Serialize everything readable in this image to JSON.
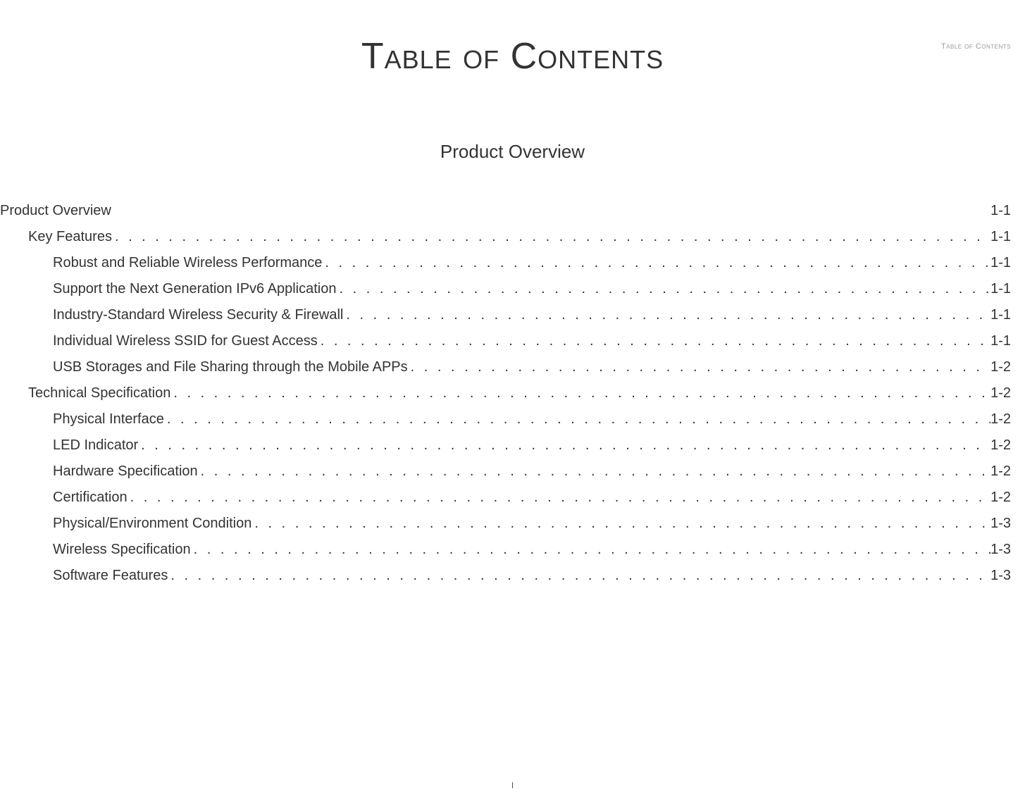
{
  "header": {
    "running_head": "Table of Contents"
  },
  "title": "Table of Contents",
  "section_title": "Product Overview",
  "toc": [
    {
      "label": "Product Overview",
      "page": "1-1",
      "level": 0,
      "leader": "space"
    },
    {
      "label": "Key Features",
      "page": "1-1",
      "level": 1,
      "leader": "dot"
    },
    {
      "label": "Robust and Reliable Wireless Performance",
      "page": "1-1",
      "level": 2,
      "leader": "dot"
    },
    {
      "label": "Support the Next Generation IPv6 Application",
      "page": "1-1",
      "level": 2,
      "leader": "dot"
    },
    {
      "label": "Industry-Standard Wireless Security & Firewall",
      "page": "1-1",
      "level": 2,
      "leader": "dot"
    },
    {
      "label": "Individual Wireless SSID for Guest Access",
      "page": "1-1",
      "level": 2,
      "leader": "dot"
    },
    {
      "label": "USB Storages and File Sharing through the Mobile APPs",
      "page": "1-2",
      "level": 2,
      "leader": "dot"
    },
    {
      "label": "Technical Specification",
      "page": "1-2",
      "level": 1,
      "leader": "dot"
    },
    {
      "label": "Physical Interface",
      "page": "1-2",
      "level": 2,
      "leader": "dot"
    },
    {
      "label": "LED Indicator",
      "page": "1-2",
      "level": 2,
      "leader": "dot"
    },
    {
      "label": "Hardware Specification",
      "page": "1-2",
      "level": 2,
      "leader": "dot"
    },
    {
      "label": "Certification",
      "page": "1-2",
      "level": 2,
      "leader": "dot"
    },
    {
      "label": "Physical/Environment Condition",
      "page": "1-3",
      "level": 2,
      "leader": "dot"
    },
    {
      "label": "Wireless Specification",
      "page": "1-3",
      "level": 2,
      "leader": "dot"
    },
    {
      "label": "Software Features",
      "page": "1-3",
      "level": 2,
      "leader": "dot",
      "software": true
    }
  ],
  "footer": {
    "page_marker": "I"
  }
}
